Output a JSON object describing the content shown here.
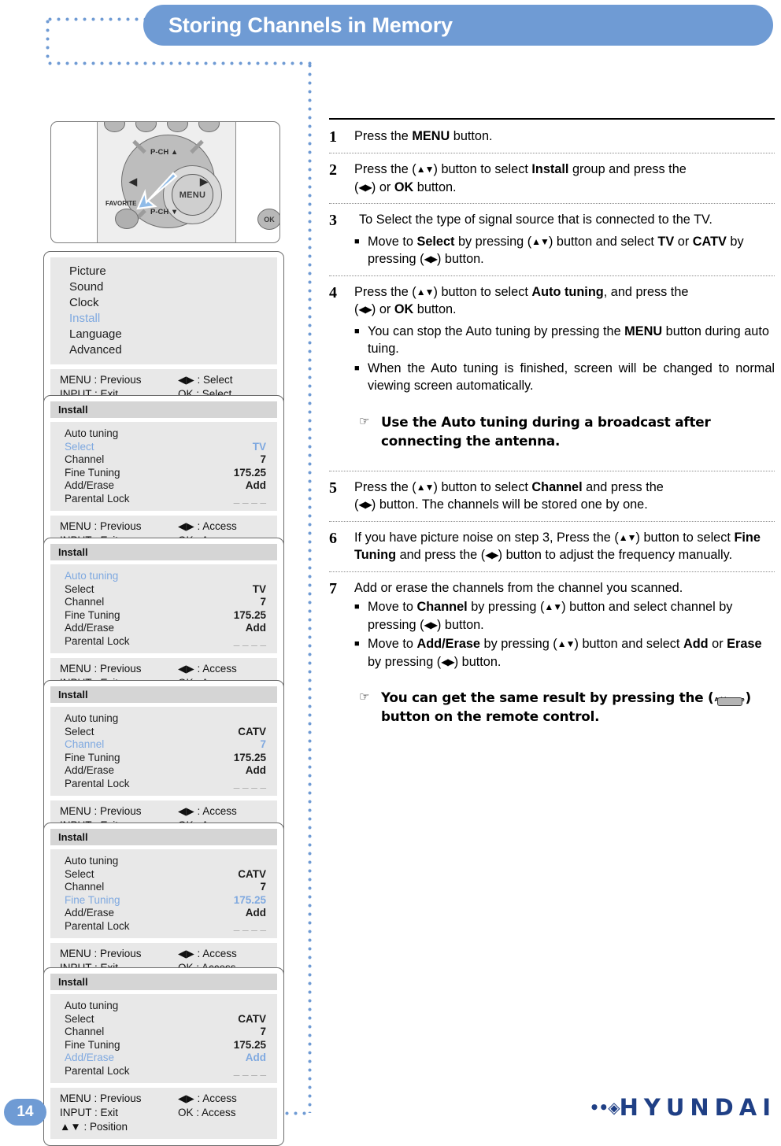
{
  "header": {
    "title": "Storing Channels in Memory"
  },
  "remote": {
    "menu_label": "MENU",
    "up_label": "P-CH ▲",
    "down_label": "P-CH ▼",
    "left_label": "◀",
    "right_label": "▶",
    "favorite_label": "FAVORITE",
    "ok_label": "OK"
  },
  "osd_common": {
    "foot_menu": "MENU : Previous",
    "foot_input": "INPUT : Exit",
    "foot_position": "▲▼ : Position",
    "select_right": "◀▶ : Select",
    "select_ok": "OK : Select",
    "access_right": "◀▶ : Access",
    "access_ok": "OK : Access",
    "highlight_color": "#7fa9e0"
  },
  "osd_main": {
    "items": [
      "Picture",
      "Sound",
      "Clock",
      "Install",
      "Language",
      "Advanced"
    ],
    "highlighted": "Install"
  },
  "osd_panels": [
    {
      "title": "Install",
      "highlighted": "Select",
      "rows": [
        {
          "label": "Auto tuning",
          "value": ""
        },
        {
          "label": "Select",
          "value": "TV"
        },
        {
          "label": "Channel",
          "value": "7"
        },
        {
          "label": "Fine Tuning",
          "value": "175.25"
        },
        {
          "label": "Add/Erase",
          "value": "Add"
        },
        {
          "label": "Parental Lock",
          "value": "_ _ _ _"
        }
      ]
    },
    {
      "title": "Install",
      "highlighted": "Auto tuning",
      "rows": [
        {
          "label": "Auto tuning",
          "value": ""
        },
        {
          "label": "Select",
          "value": "TV"
        },
        {
          "label": "Channel",
          "value": "7"
        },
        {
          "label": "Fine Tuning",
          "value": "175.25"
        },
        {
          "label": "Add/Erase",
          "value": "Add"
        },
        {
          "label": "Parental Lock",
          "value": "_ _ _ _"
        }
      ]
    },
    {
      "title": "Install",
      "highlighted": "Channel",
      "rows": [
        {
          "label": "Auto tuning",
          "value": ""
        },
        {
          "label": "Select",
          "value": "CATV"
        },
        {
          "label": "Channel",
          "value": "7"
        },
        {
          "label": "Fine Tuning",
          "value": "175.25"
        },
        {
          "label": "Add/Erase",
          "value": "Add"
        },
        {
          "label": "Parental Lock",
          "value": "_ _ _ _"
        }
      ]
    },
    {
      "title": "Install",
      "highlighted": "Fine Tuning",
      "rows": [
        {
          "label": "Auto tuning",
          "value": ""
        },
        {
          "label": "Select",
          "value": "CATV"
        },
        {
          "label": "Channel",
          "value": "7"
        },
        {
          "label": "Fine Tuning",
          "value": "175.25"
        },
        {
          "label": "Add/Erase",
          "value": "Add"
        },
        {
          "label": "Parental Lock",
          "value": "_ _ _ _"
        }
      ]
    },
    {
      "title": "Install",
      "highlighted": "Add/Erase",
      "rows": [
        {
          "label": "Auto tuning",
          "value": ""
        },
        {
          "label": "Select",
          "value": "CATV"
        },
        {
          "label": "Channel",
          "value": "7"
        },
        {
          "label": "Fine Tuning",
          "value": "175.25"
        },
        {
          "label": "Add/Erase",
          "value": "Add"
        },
        {
          "label": "Parental Lock",
          "value": "_ _ _ _"
        }
      ]
    }
  ],
  "steps": {
    "s1": {
      "num": "1",
      "text_a": "Press the ",
      "bold_a": "MENU",
      "text_b": " button."
    },
    "s2": {
      "num": "2",
      "line1_a": "Press the (",
      "arrows1": "▲▼",
      "line1_b": ") button to select ",
      "bold1": "Install",
      "line1_c": " group and press the",
      "line2_a": "(",
      "arrows2": "◀▶",
      "line2_b": ") or ",
      "bold2": "OK",
      "line2_c": " button."
    },
    "s3": {
      "num": "3",
      "lead": "To Select the type of signal source that is connected to the TV.",
      "b1_a": "Move to ",
      "b1_bold1": "Select",
      "b1_b": " by pressing (",
      "b1_arrows": "▲▼",
      "b1_c": ") button and select ",
      "b1_bold2": "TV",
      "b1_d": " or ",
      "b1_bold3": "CATV",
      "b1_e": " by pressing (",
      "b1_arrows2": "◀▶",
      "b1_f": ") button."
    },
    "s4": {
      "num": "4",
      "line1_a": "Press the (",
      "arrows1": "▲▼",
      "line1_b": ") button to select ",
      "bold1": "Auto tuning",
      "line1_c": ", and press the",
      "line2_a": "(",
      "arrows2": "◀▶",
      "line2_b": ") or ",
      "bold2": "OK",
      "line2_c": " button.",
      "b1_a": "You can stop the Auto tuning by pressing the ",
      "b1_bold": "MENU",
      "b1_b": " button during auto tuing.",
      "b2": "When the Auto tuning is finished, screen will be changed to normal viewing screen automatically.",
      "note_mark": "☞",
      "note": "Use the Auto tuning during a broadcast after connecting the antenna."
    },
    "s5": {
      "num": "5",
      "line1_a": "Press the (",
      "arrows1": "▲▼",
      "line1_b": ") button to select ",
      "bold1": "Channel",
      "line1_c": " and press the",
      "line2_a": "(",
      "arrows2": "◀▶",
      "line2_b": ") button. The channels will be stored one by one."
    },
    "s6": {
      "num": "6",
      "line1_a": "If you have picture noise on step 3, Press the (",
      "arrows1": "▲▼",
      "line1_b": ") button to select ",
      "bold1": "Fine Tuning",
      "line1_c": " and press the (",
      "arrows2": "◀▶",
      "line1_d": ") button to adjust the frequency manually."
    },
    "s7": {
      "num": "7",
      "lead": "Add or erase the channels from the channel you scanned.",
      "b1_a": "Move to ",
      "b1_bold": "Channel",
      "b1_b": " by pressing (",
      "b1_arrows": "▲▼",
      "b1_c": ") button and select channel by pressing (",
      "b1_arrows2": "◀▶",
      "b1_d": ") button.",
      "b2_a": "Move to ",
      "b2_bold": "Add/Erase",
      "b2_b": " by pressing (",
      "b2_arrows": "▲▼",
      "b2_c": ") button and select ",
      "b2_bold2": "Add",
      "b2_d": " or ",
      "b2_bold3": "Erase",
      "b2_e": " by pressing (",
      "b2_arrows2": "◀▶",
      "b2_f": ") button.",
      "note_mark": "☞",
      "note_a": "You can get the same result by pressing the (",
      "note_btn_label": "Add/Erase",
      "note_b": ") button on the remote control."
    }
  },
  "footer": {
    "page_number": "14",
    "brand": "HYUNDAI",
    "brand_dots": "••◈",
    "brand_color": "#1f3f85"
  },
  "theme": {
    "accent": "#6f9bd4"
  }
}
